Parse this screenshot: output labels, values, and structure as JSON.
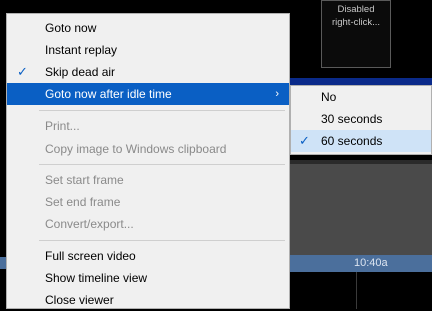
{
  "background": {
    "thumbnail_text_line1": "Disabled",
    "thumbnail_text_line2": "right-click...",
    "timeline_time": "10:40a"
  },
  "menu": {
    "items": [
      {
        "label": "Goto now",
        "checked": false,
        "disabled": false
      },
      {
        "label": "Instant replay",
        "checked": false,
        "disabled": false
      },
      {
        "label": "Skip dead air",
        "checked": true,
        "disabled": false
      },
      {
        "label": "Goto now after idle time",
        "checked": false,
        "disabled": false,
        "submenu": true
      },
      {
        "label": "Print...",
        "checked": false,
        "disabled": true
      },
      {
        "label": "Copy image to Windows clipboard",
        "checked": false,
        "disabled": true
      },
      {
        "label": "Set start frame",
        "checked": false,
        "disabled": true
      },
      {
        "label": "Set end frame",
        "checked": false,
        "disabled": true
      },
      {
        "label": "Convert/export...",
        "checked": false,
        "disabled": true
      },
      {
        "label": "Full screen video",
        "checked": false,
        "disabled": false
      },
      {
        "label": "Show timeline view",
        "checked": false,
        "disabled": false
      },
      {
        "label": "Close viewer",
        "checked": false,
        "disabled": false
      }
    ],
    "checkmark": "✓",
    "submenu_arrow": "›"
  },
  "submenu": {
    "items": [
      {
        "label": "No",
        "checked": false
      },
      {
        "label": "30 seconds",
        "checked": false
      },
      {
        "label": "60 seconds",
        "checked": true
      }
    ]
  },
  "colors": {
    "highlight": "#0a5fc4",
    "disabled_text": "#8a8a8a",
    "menu_bg": "#f0f0f0"
  }
}
